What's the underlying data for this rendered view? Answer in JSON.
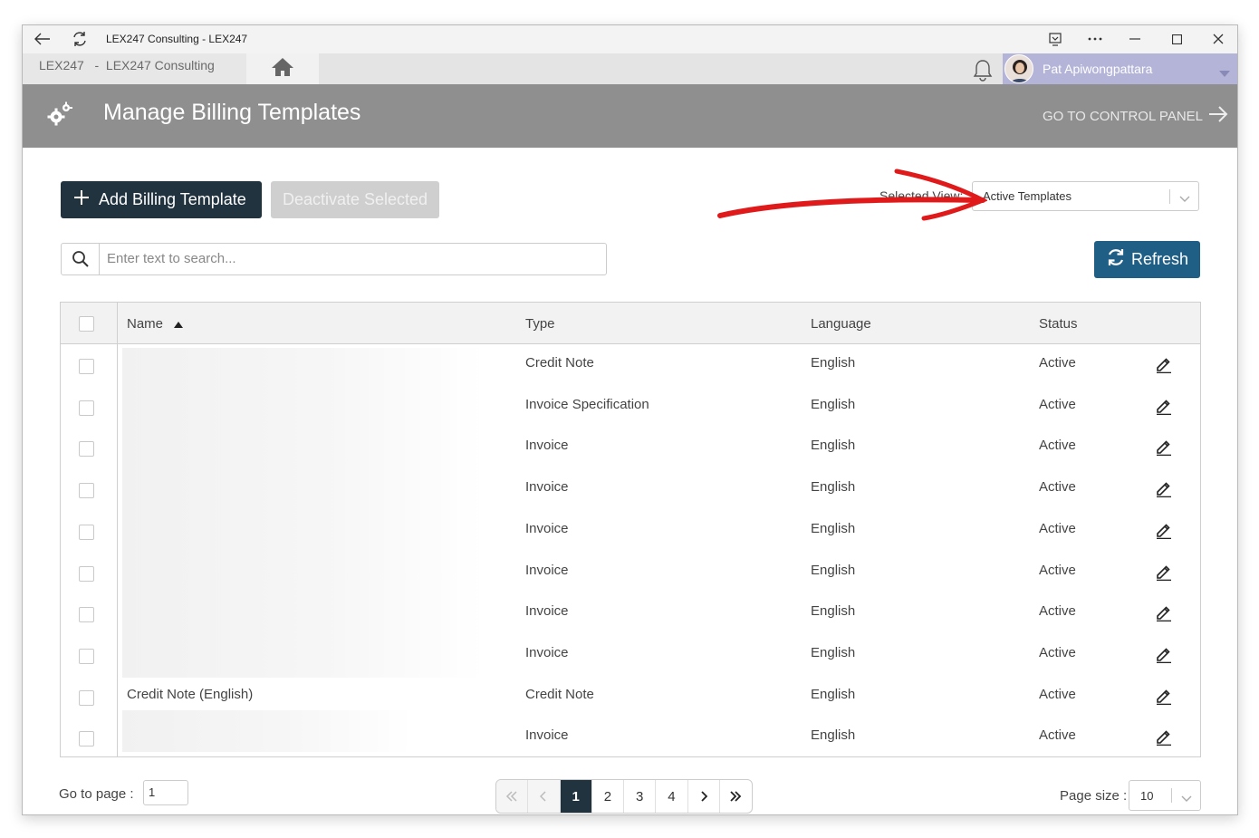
{
  "window": {
    "title": "LEX247 Consulting - LEX247"
  },
  "appbar": {
    "tab_label": "LEX247   -  LEX247 Consulting",
    "user_name": "Pat Apiwongpattara"
  },
  "header": {
    "title": "Manage Billing Templates",
    "control_panel_link": "GO TO CONTROL PANEL"
  },
  "toolbar": {
    "add_label": "Add Billing Template",
    "deactivate_label": "Deactivate Selected",
    "view_label": "Selected View:",
    "view_value": "Active Templates"
  },
  "search": {
    "placeholder": "Enter text to search...",
    "refresh_label": "Refresh"
  },
  "table": {
    "columns": {
      "name": "Name",
      "type": "Type",
      "language": "Language",
      "status": "Status"
    },
    "rows": [
      {
        "name": "",
        "type": "Credit Note",
        "language": "English",
        "status": "Active"
      },
      {
        "name": "",
        "type": "Invoice Specification",
        "language": "English",
        "status": "Active"
      },
      {
        "name": "",
        "type": "Invoice",
        "language": "English",
        "status": "Active"
      },
      {
        "name": "",
        "type": "Invoice",
        "language": "English",
        "status": "Active"
      },
      {
        "name": "",
        "type": "Invoice",
        "language": "English",
        "status": "Active"
      },
      {
        "name": "",
        "type": "Invoice",
        "language": "English",
        "status": "Active"
      },
      {
        "name": "",
        "type": "Invoice",
        "language": "English",
        "status": "Active"
      },
      {
        "name": "",
        "type": "Invoice",
        "language": "English",
        "status": "Active"
      },
      {
        "name": "Credit Note (English)",
        "type": "Credit Note",
        "language": "English",
        "status": "Active"
      },
      {
        "name": "",
        "type": "Invoice",
        "language": "English",
        "status": "Active"
      }
    ]
  },
  "footer": {
    "goto_label": "Go to page :",
    "goto_value": "1",
    "pages": [
      "1",
      "2",
      "3",
      "4"
    ],
    "current_page": "1",
    "page_size_label": "Page size :",
    "page_size_value": "10"
  },
  "colors": {
    "header_bg": "#8f8f8f",
    "primary_dark": "#21333f",
    "refresh_blue": "#1f5f86",
    "user_block": "#b4b4d8",
    "annotation_red": "#e0191a"
  },
  "icons": [
    "back-icon",
    "refresh-window-icon",
    "cast-icon",
    "more-icon",
    "minimize-icon",
    "maximize-icon",
    "close-icon",
    "home-icon",
    "bell-icon",
    "gear-icon",
    "arrow-right-icon",
    "plus-icon",
    "chevron-down-icon",
    "search-icon",
    "sync-icon",
    "sort-up-icon",
    "edit-icon"
  ]
}
